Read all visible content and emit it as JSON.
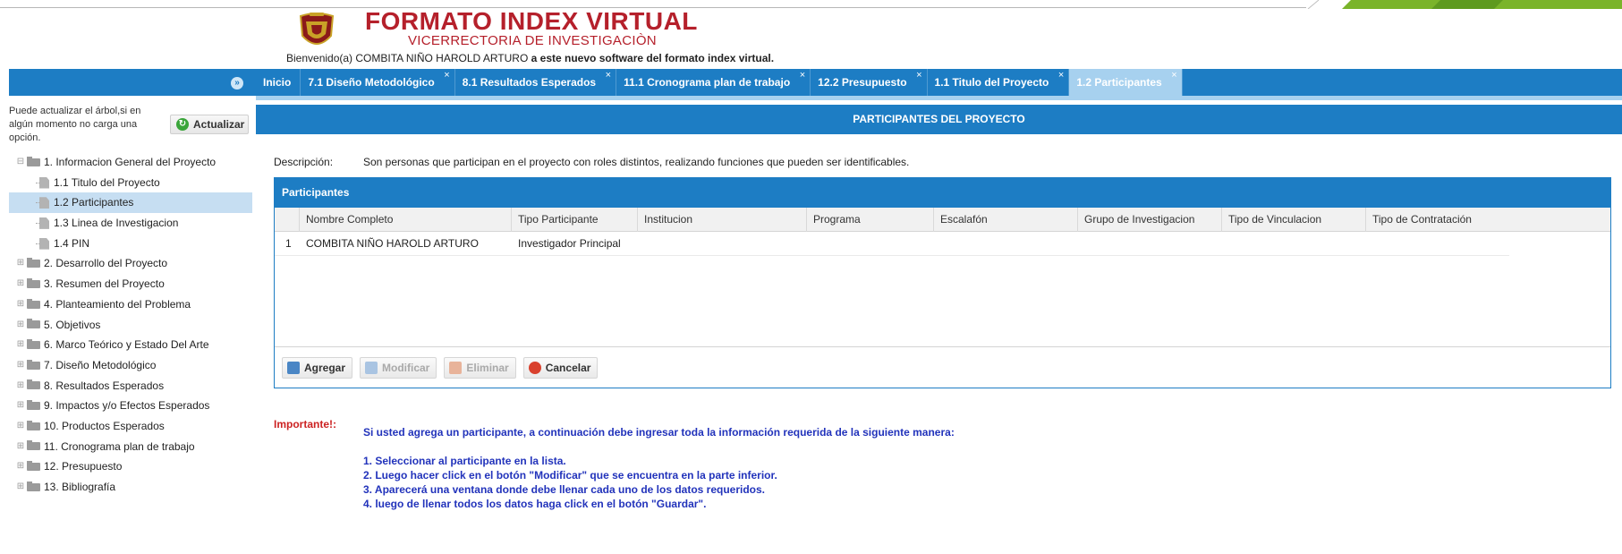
{
  "header": {
    "title": "FORMATO INDEX VIRTUAL",
    "subtitle": "VICERRECTORIA DE INVESTIGACIÒN",
    "welcome_prefix": "Bienvenido(a)",
    "user_name": "COMBITA NIÑO HAROLD ARTURO",
    "welcome_suffix": "a este nuevo software del formato index virtual."
  },
  "tabs": [
    {
      "label": "Inicio",
      "closable": false
    },
    {
      "label": "7.1 Diseño Metodológico",
      "closable": true
    },
    {
      "label": "8.1 Resultados Esperados",
      "closable": true
    },
    {
      "label": "11.1 Cronograma plan de trabajo",
      "closable": true
    },
    {
      "label": "12.2 Presupuesto",
      "closable": true
    },
    {
      "label": "1.1 Titulo del Proyecto",
      "closable": true
    },
    {
      "label": "1.2 Participantes",
      "closable": true,
      "active": true
    }
  ],
  "sidebar": {
    "refresh_note": "Puede actualizar el árbol,si en algún momento no carga una opción.",
    "refresh_button": "Actualizar",
    "tree": [
      {
        "label": "1. Informacion General del Proyecto",
        "type": "folder",
        "expanded": true
      },
      {
        "label": "1.1 Titulo del Proyecto",
        "type": "doc"
      },
      {
        "label": "1.2 Participantes",
        "type": "doc",
        "selected": true
      },
      {
        "label": "1.3 Linea de Investigacion",
        "type": "doc"
      },
      {
        "label": "1.4 PIN",
        "type": "doc"
      },
      {
        "label": "2. Desarrollo del Proyecto",
        "type": "folder"
      },
      {
        "label": "3. Resumen del Proyecto",
        "type": "folder"
      },
      {
        "label": "4. Planteamiento del Problema",
        "type": "folder"
      },
      {
        "label": "5. Objetivos",
        "type": "folder"
      },
      {
        "label": "6. Marco Teórico y Estado Del Arte",
        "type": "folder"
      },
      {
        "label": "7. Diseño Metodológico",
        "type": "folder"
      },
      {
        "label": "8. Resultados Esperados",
        "type": "folder"
      },
      {
        "label": "9. Impactos y/o Efectos Esperados",
        "type": "folder"
      },
      {
        "label": "10. Productos Esperados",
        "type": "folder"
      },
      {
        "label": "11. Cronograma plan de trabajo",
        "type": "folder"
      },
      {
        "label": "12. Presupuesto",
        "type": "folder"
      },
      {
        "label": "13. Bibliografía",
        "type": "folder"
      }
    ]
  },
  "main": {
    "header": "PARTICIPANTES DEL PROYECTO",
    "description_label": "Descripción:",
    "description": "Son personas que participan en el proyecto con roles distintos, realizando funciones que pueden ser identificables.",
    "grid": {
      "title": "Participantes",
      "columns": [
        "Nombre Completo",
        "Tipo Participante",
        "Institucion",
        "Programa",
        "Escalafón",
        "Grupo de Investigacion",
        "Tipo de Vinculacion",
        "Tipo de Contratación"
      ],
      "rows": [
        {
          "num": "1",
          "cells": [
            "COMBITA NIÑO HAROLD ARTURO",
            "Investigador Principal",
            "",
            "",
            "",
            "",
            "",
            ""
          ]
        }
      ],
      "toolbar": {
        "add": "Agregar",
        "modify": "Modificar",
        "delete": "Eliminar",
        "cancel": "Cancelar"
      }
    },
    "important": {
      "label": "Importante!:",
      "intro": "Si usted agrega un participante, a continuación debe ingresar toda la información requerida de la siguiente manera:",
      "steps": [
        "1. Seleccionar al participante en la lista.",
        "2. Luego hacer click en el botón \"Modificar\" que se encuentra en la parte inferior.",
        "3. Aparecerá una ventana donde debe llenar cada uno de los datos requeridos.",
        "4. luego de llenar todos los datos haga click en el botón \"Guardar\"."
      ]
    }
  },
  "colors": {
    "primary": "#1d7dc4",
    "active_tab": "#a7d1ef",
    "title_red": "#b5202b",
    "important_red": "#cc2222",
    "instruction_blue": "#2233bb"
  }
}
